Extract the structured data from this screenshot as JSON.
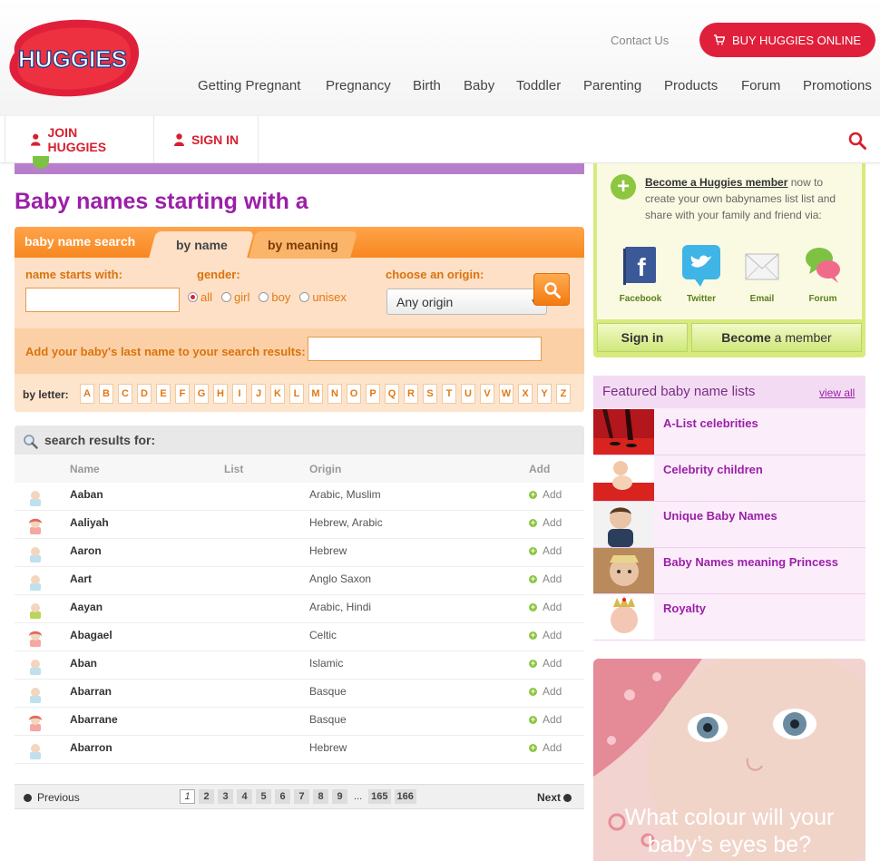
{
  "brand": {
    "logo_text": "HUGGIES",
    "accent": "#e0203a",
    "purple": "#9b1fa8",
    "orange": "#f7871f"
  },
  "header": {
    "contact": "Contact Us",
    "buy": "BUY HUGGIES ONLINE",
    "nav": [
      "Getting Pregnant",
      "Pregnancy",
      "Birth",
      "Baby",
      "Toddler",
      "Parenting",
      "Products",
      "Forum",
      "Promotions"
    ]
  },
  "memberbar": {
    "join": "JOIN HUGGIES",
    "signin": "SIGN IN"
  },
  "page_title": "Baby names starting with a",
  "search": {
    "panel_title": "baby name search",
    "tab_name": "by name",
    "tab_meaning": "by meaning",
    "name_label": "name starts with:",
    "name_value": "",
    "gender_label": "gender:",
    "genders": [
      "all",
      "girl",
      "boy",
      "unisex"
    ],
    "gender_selected": "all",
    "origin_label": "choose an origin:",
    "origin_value": "Any origin",
    "lastname_label": "Add your baby's last name to your search results:",
    "lastname_value": "",
    "by_letter": "by letter:",
    "letters": [
      "A",
      "B",
      "C",
      "D",
      "E",
      "F",
      "G",
      "H",
      "I",
      "J",
      "K",
      "L",
      "M",
      "N",
      "O",
      "P",
      "Q",
      "R",
      "S",
      "T",
      "U",
      "V",
      "W",
      "X",
      "Y",
      "Z"
    ]
  },
  "results": {
    "title": "search results for:",
    "columns": {
      "name": "Name",
      "list": "List",
      "origin": "Origin",
      "add": "Add"
    },
    "add_label": "Add",
    "rows": [
      {
        "name": "Aaban",
        "origin": "Arabic, Muslim",
        "gender": "boy"
      },
      {
        "name": "Aaliyah",
        "origin": "Hebrew, Arabic",
        "gender": "girl"
      },
      {
        "name": "Aaron",
        "origin": "Hebrew",
        "gender": "boy"
      },
      {
        "name": "Aart",
        "origin": "Anglo Saxon",
        "gender": "boy"
      },
      {
        "name": "Aayan",
        "origin": "Arabic, Hindi",
        "gender": "unisex"
      },
      {
        "name": "Abagael",
        "origin": "Celtic",
        "gender": "girl"
      },
      {
        "name": "Aban",
        "origin": "Islamic",
        "gender": "boy"
      },
      {
        "name": "Abarran",
        "origin": "Basque",
        "gender": "boy"
      },
      {
        "name": "Abarrane",
        "origin": "Basque",
        "gender": "girl"
      },
      {
        "name": "Abarron",
        "origin": "Hebrew",
        "gender": "boy"
      }
    ]
  },
  "pager": {
    "previous": "Previous",
    "next": "Next",
    "pages": [
      "1",
      "2",
      "3",
      "4",
      "5",
      "6",
      "7",
      "8",
      "9",
      "...",
      "165",
      "166"
    ],
    "current": "1"
  },
  "member": {
    "link": "Become a Huggies member",
    "text": " now to create your own babynames list list and share with your family and friend via:",
    "social": [
      "Facebook",
      "Twitter",
      "Email",
      "Forum"
    ],
    "signin": "Sign in",
    "become_bold": "Become",
    "become_rest": " a member"
  },
  "featured": {
    "title": "Featured baby name lists",
    "view_all": "view all",
    "items": [
      "A-List celebrities",
      "Celebrity children",
      "Unique Baby Names",
      "Baby Names meaning Princess",
      "Royalty"
    ]
  },
  "ad": {
    "line1": "What colour will your",
    "line2": "baby’s eyes be?"
  }
}
